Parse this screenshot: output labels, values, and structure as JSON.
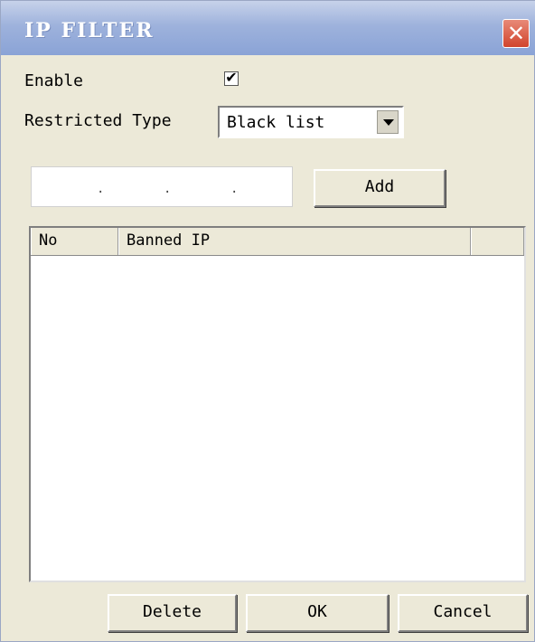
{
  "window": {
    "title": "IP FILTER",
    "close_glyph": "✕"
  },
  "form": {
    "enable_label": "Enable",
    "enable_checked": true,
    "checkmark": "✔",
    "restricted_type_label": "Restricted Type",
    "restricted_type_value": "Black list",
    "ip_value": "",
    "ip_dots": [
      ".",
      ".",
      "."
    ],
    "add_label": "Add"
  },
  "list": {
    "columns": [
      "No",
      "Banned IP",
      ""
    ],
    "rows": []
  },
  "footer": {
    "delete_label": "Delete",
    "ok_label": "OK",
    "cancel_label": "Cancel"
  },
  "icons": {
    "close": "close-icon",
    "dropdown": "chevron-down-icon"
  },
  "colors": {
    "title_bar": "#9eb2dc",
    "close_button": "#d1442c",
    "dialog_bg": "#ece9d8"
  }
}
